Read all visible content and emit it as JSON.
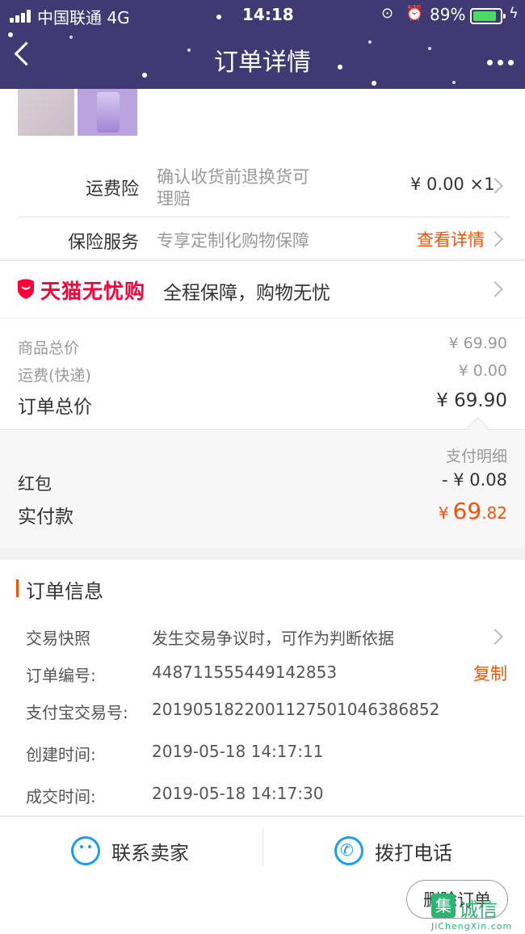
{
  "status_bar": {
    "carrier": "中国联通  4G",
    "time": "14:18",
    "battery": "89%"
  },
  "header": {
    "title": "订单详情"
  },
  "freight_insurance": {
    "label": "运费险",
    "desc_line1": "确认收货前退换货可",
    "desc_line2": "理赔",
    "value": "¥ 0.00 ×1"
  },
  "insurance_service": {
    "label": "保险服务",
    "desc": "专享定制化购物保障",
    "link": "查看详情"
  },
  "tmall": {
    "brand": "天猫无忧购",
    "slogan": "全程保障，购物无忧"
  },
  "summary": {
    "goods_label": "商品总价",
    "goods_value": "¥ 69.90",
    "shipping_label": "运费(快递)",
    "shipping_value": "¥ 0.00",
    "total_label": "订单总价",
    "total_value": "¥ 69.90"
  },
  "payment": {
    "detail_link": "支付明细",
    "redpacket_label": "红包",
    "redpacket_value": "- ¥ 0.08",
    "paid_label": "实付款",
    "paid_currency": "¥",
    "paid_int": "69",
    "paid_dec": ".82"
  },
  "order_info": {
    "title": "订单信息",
    "snapshot_label": "交易快照",
    "snapshot_value": "发生交易争议时，可作为判断依据",
    "order_no_label": "订单编号:",
    "order_no_value": "448711555449142853",
    "copy_label": "复制",
    "alipay_label": "支付宝交易号:",
    "alipay_value": "2019051822001127501046386852",
    "created_label": "创建时间:",
    "created_value": "2019-05-18 14:17:11",
    "deal_label": "成交时间:",
    "deal_value": "2019-05-18 14:17:30"
  },
  "actions": {
    "contact_seller": "联系卖家",
    "call_phone": "拨打电话"
  },
  "footer": {
    "delete_button": "删除订单"
  },
  "watermark": {
    "char": "集",
    "text": "诚信",
    "url": "JiChengXin.com"
  },
  "colors": {
    "header_bg": "#3f3a73",
    "accent": "#ff5000",
    "tmall_red": "#ff0036",
    "blue": "#1a9df2"
  }
}
